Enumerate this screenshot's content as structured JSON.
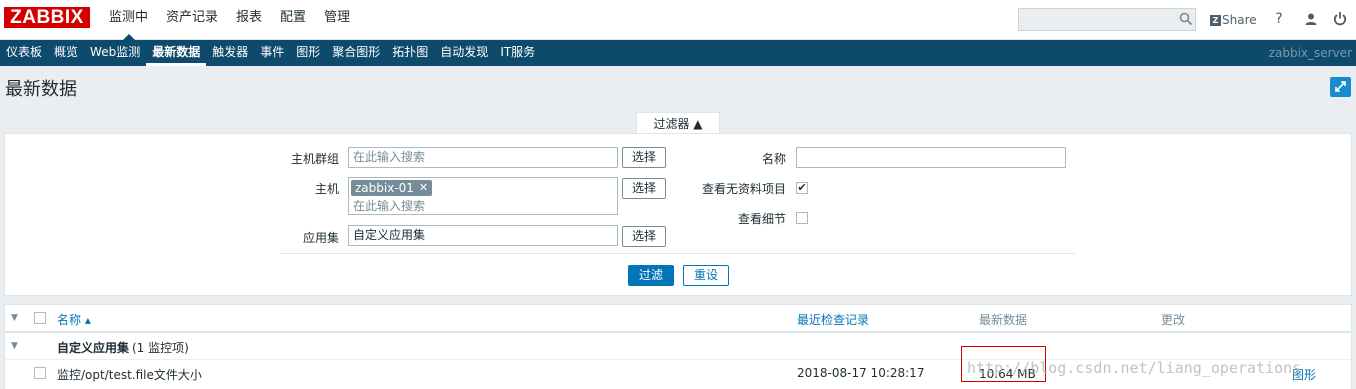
{
  "logo": "ZABBIX",
  "top_menu": [
    {
      "label": "监测中",
      "active": true
    },
    {
      "label": "资产记录",
      "active": false
    },
    {
      "label": "报表",
      "active": false
    },
    {
      "label": "配置",
      "active": false
    },
    {
      "label": "管理",
      "active": false
    }
  ],
  "search": {
    "value": "",
    "placeholder": ""
  },
  "share_label": "Share",
  "help_label": "?",
  "sub_menu": [
    {
      "label": "仪表板",
      "active": false
    },
    {
      "label": "概览",
      "active": false
    },
    {
      "label": "Web监测",
      "active": false
    },
    {
      "label": "最新数据",
      "active": true
    },
    {
      "label": "触发器",
      "active": false
    },
    {
      "label": "事件",
      "active": false
    },
    {
      "label": "图形",
      "active": false
    },
    {
      "label": "聚合图形",
      "active": false
    },
    {
      "label": "拓扑图",
      "active": false
    },
    {
      "label": "自动发现",
      "active": false
    },
    {
      "label": "IT服务",
      "active": false
    }
  ],
  "server_name": "zabbix_server",
  "page_title": "最新数据",
  "filter": {
    "tab_label": "过滤器 ▲",
    "host_group": {
      "label": "主机群组",
      "placeholder": "在此输入搜索"
    },
    "host": {
      "label": "主机",
      "chip": "zabbix-01",
      "placeholder": "在此输入搜索"
    },
    "application": {
      "label": "应用集",
      "value": "自定义应用集"
    },
    "select_label": "选择",
    "name": {
      "label": "名称",
      "value": ""
    },
    "show_without_data": {
      "label": "查看无资料项目",
      "checked": true,
      "mark": "✔"
    },
    "show_details": {
      "label": "查看细节",
      "checked": false
    },
    "apply_label": "过滤",
    "reset_label": "重设"
  },
  "table": {
    "headers": {
      "name": "名称 ▴",
      "last_check": "最近检查记录",
      "last_value": "最新数据",
      "change": "更改"
    },
    "group": {
      "name": "自定义应用集",
      "count": "(1 监控项)"
    },
    "rows": [
      {
        "name": "监控/opt/test.file文件大小",
        "last_check": "2018-08-17 10:28:17",
        "last_value": "10.64 MB",
        "change": "",
        "graph_label": "图形"
      }
    ]
  },
  "watermark": "http://blog.csdn.net/liang_operations",
  "colors": {
    "brand": "#d40000",
    "nav": "#0e4a6b",
    "accent": "#0275b8",
    "highlight_box": "#d40000"
  }
}
